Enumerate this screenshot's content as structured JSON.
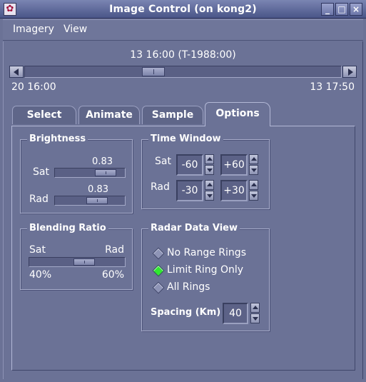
{
  "window": {
    "title": "Image Control (on kong2)",
    "app_icon": "app-logo-icon",
    "buttons": {
      "minimize": "_",
      "maximize": "□",
      "close": "×"
    }
  },
  "menu": {
    "items": [
      "Imagery",
      "View"
    ]
  },
  "timeline": {
    "current": "13 16:00 (T-1988:00)",
    "start": "20 16:00",
    "end": "13 17:50",
    "position": 0.4
  },
  "tabs": [
    {
      "label": "Select",
      "active": false
    },
    {
      "label": "Animate",
      "active": false
    },
    {
      "label": "Sample",
      "active": false
    },
    {
      "label": "Options",
      "active": true
    }
  ],
  "brightness": {
    "title": "Brightness",
    "sat": {
      "label": "Sat",
      "value": "0.83",
      "level": 0.83
    },
    "rad": {
      "label": "Rad",
      "value": "0.83",
      "level": 0.83
    }
  },
  "time_window": {
    "title": "Time Window",
    "sat": {
      "label": "Sat",
      "low": "-60",
      "high": "+60"
    },
    "rad": {
      "label": "Rad",
      "low": "-30",
      "high": "+30"
    }
  },
  "blending": {
    "title": "Blending Ratio",
    "left_label": "Sat",
    "right_label": "Rad",
    "left_value": "40%",
    "right_value": "60%",
    "ratio": 0.6
  },
  "radar_view": {
    "title": "Radar Data View",
    "options": [
      {
        "label": "No Range Rings",
        "selected": false
      },
      {
        "label": "Limit Ring Only",
        "selected": true
      },
      {
        "label": "All Rings",
        "selected": false
      }
    ],
    "spacing_label": "Spacing (Km)",
    "spacing_value": "40"
  },
  "colors": {
    "background": "#6b7296",
    "selected_radio": "#2fe82f"
  }
}
